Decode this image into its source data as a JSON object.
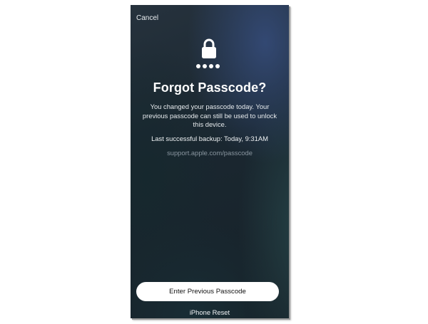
{
  "header": {
    "cancel_label": "Cancel"
  },
  "icons": {
    "lock": "lock-icon",
    "passcode_dots": 4
  },
  "main": {
    "title": "Forgot Passcode?",
    "message": "You changed your passcode today. Your previous passcode can still be used to unlock this device.",
    "backup_info": "Last successful backup: Today, 9:31AM",
    "support_link": "support.apple.com/passcode"
  },
  "actions": {
    "primary_label": "Enter Previous Passcode",
    "secondary_label": "iPhone Reset"
  },
  "colors": {
    "text_primary": "#ffffff",
    "link": "#8a96a0",
    "button_bg": "#ffffff"
  }
}
